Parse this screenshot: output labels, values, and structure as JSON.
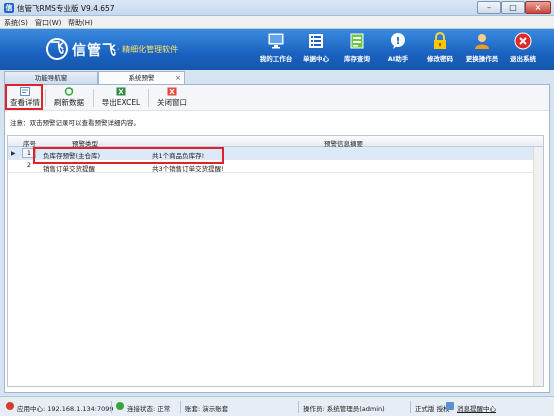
{
  "window": {
    "title": "信管飞RMS专业版 V9.4.657"
  },
  "menu": {
    "items": [
      "系统(S)",
      "窗口(W)",
      "帮助(H)"
    ]
  },
  "banner": {
    "logo_text": "信管飞",
    "slogan": "· 精细化管理软件",
    "tools": [
      {
        "label": "我的工作台",
        "icon": "monitor-icon"
      },
      {
        "label": "单据中心",
        "icon": "document-list-icon"
      },
      {
        "label": "库存查询",
        "icon": "inventory-icon"
      },
      {
        "label": "AI助手",
        "icon": "ai-assistant-icon"
      },
      {
        "label": "修改密码",
        "icon": "lock-icon"
      },
      {
        "label": "更换操作员",
        "icon": "user-icon"
      },
      {
        "label": "退出系统",
        "icon": "exit-icon"
      }
    ]
  },
  "tabs": [
    {
      "label": "功能导航窗"
    },
    {
      "label": "系统预警",
      "close": "×"
    }
  ],
  "toolbar": {
    "view_label": "查看详情",
    "refresh_label": "刷新数据",
    "export_label": "导出EXCEL",
    "close_label": "关闭窗口"
  },
  "notice": "注意：双击预警记录可以查看预警详细内容。",
  "grid": {
    "headers": [
      "序号",
      "预警类型",
      "预警信息摘要"
    ],
    "rows": [
      {
        "no": "1",
        "type": "负库存预警(主仓库)",
        "summary": "共1个商品负库存!"
      },
      {
        "no": "2",
        "type": "销售订单交货提醒",
        "summary": "共3个销售订单交货提醒!"
      }
    ]
  },
  "status": {
    "app_center": "应用中心: 192.168.1.134:7099",
    "connection": "连接状态: 正常",
    "account": "账套: 演示账套",
    "operator": "操作员: 系统管理员(admin)",
    "license": "正式版 授权",
    "message_center": "消息提醒中心"
  },
  "colors": {
    "banner": "#1a62c0",
    "highlight": "#e0232a",
    "selected_row": "#dce9f8"
  }
}
